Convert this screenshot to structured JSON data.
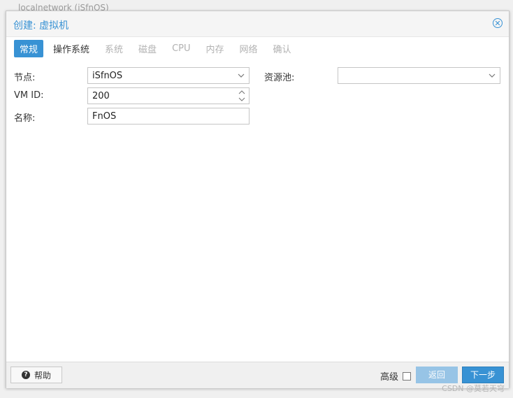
{
  "background": {
    "window_title": "localnetwork (iSfnOS)"
  },
  "dialog": {
    "title": "创建: 虚拟机",
    "close_icon": "close-circle-icon"
  },
  "tabs": [
    {
      "label": "常规",
      "state": "active"
    },
    {
      "label": "操作系统",
      "state": "enabled"
    },
    {
      "label": "系统",
      "state": "disabled"
    },
    {
      "label": "磁盘",
      "state": "disabled"
    },
    {
      "label": "CPU",
      "state": "disabled"
    },
    {
      "label": "内存",
      "state": "disabled"
    },
    {
      "label": "网络",
      "state": "disabled"
    },
    {
      "label": "确认",
      "state": "disabled"
    }
  ],
  "form": {
    "node": {
      "label": "节点:",
      "value": "iSfnOS"
    },
    "vmid": {
      "label": "VM ID:",
      "value": "200"
    },
    "name": {
      "label": "名称:",
      "value": "FnOS"
    },
    "pool": {
      "label": "资源池:",
      "value": ""
    }
  },
  "footer": {
    "help_label": "帮助",
    "advanced_label": "高级",
    "advanced_checked": false,
    "back_label": "返回",
    "next_label": "下一步"
  },
  "watermark": "CSDN @莫若天穹",
  "colors": {
    "accent": "#3892d4",
    "disabled_text": "#b2b2b2"
  }
}
